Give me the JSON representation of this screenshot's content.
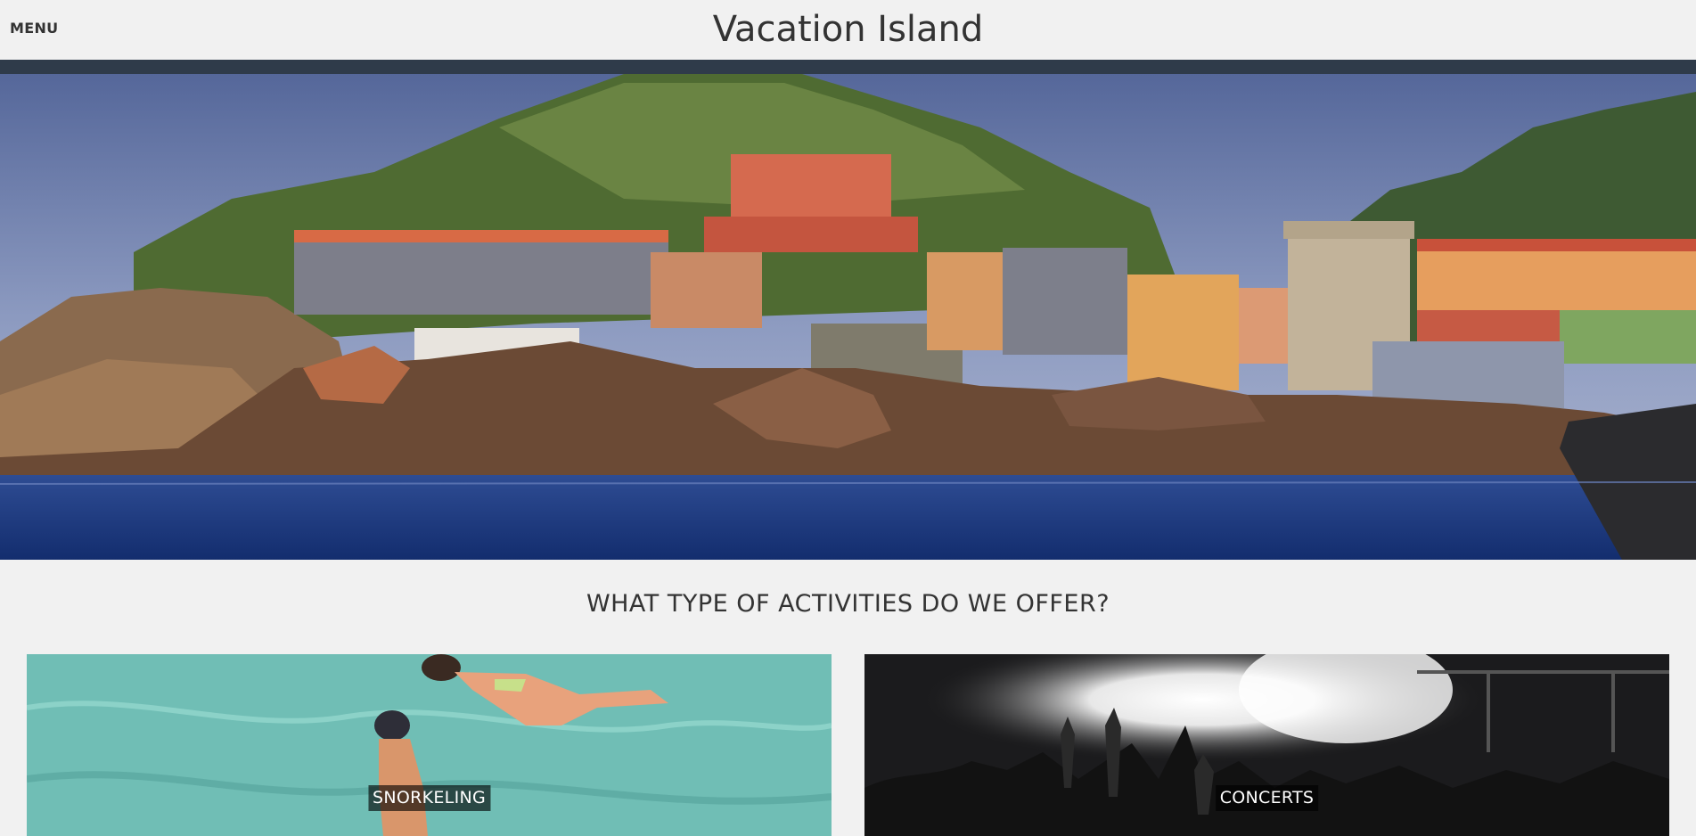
{
  "header": {
    "menu_label": "MENU",
    "title": "Vacation Island",
    "bar_color": "#2f3b4a"
  },
  "hero": {
    "image": "island-village-photo"
  },
  "activities": {
    "heading": "WHAT TYPE OF ACTIVITIES DO WE OFFER?",
    "cards": [
      {
        "label": "SNORKELING",
        "image": "snorkeling-photo"
      },
      {
        "label": "CONCERTS",
        "image": "concert-photo"
      }
    ]
  }
}
